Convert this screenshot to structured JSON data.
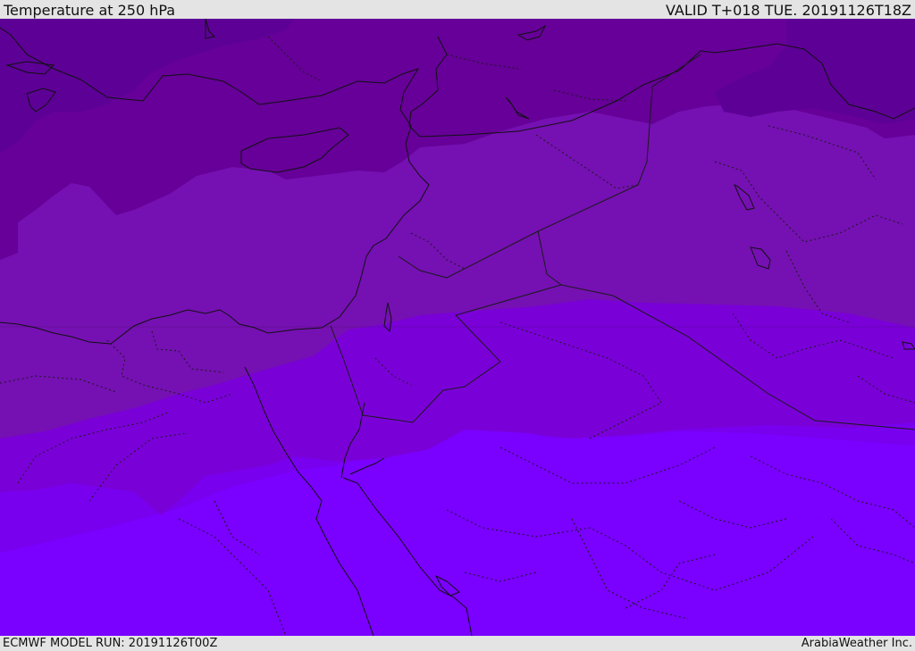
{
  "header": {
    "title": "Temperature at 250 hPa",
    "valid_time": "VALID T+018 TUE. 20191126T18Z"
  },
  "footer": {
    "model_run": "ECMWF MODEL RUN: 20191126T00Z",
    "credit": "ArabiaWeather Inc."
  },
  "map": {
    "field": "temperature",
    "level": "250 hPa",
    "region": "Eastern Mediterranean / Middle East",
    "colors": {
      "band_coldest": "#5d0096",
      "band_cold": "#660098",
      "band_mid": "#7510b2",
      "band_warm": "#7a00d8",
      "band_warmer": "#7800ee",
      "band_warmest": "#7a00ff",
      "coastline": "#111111",
      "border": "#1a1a1a"
    }
  }
}
